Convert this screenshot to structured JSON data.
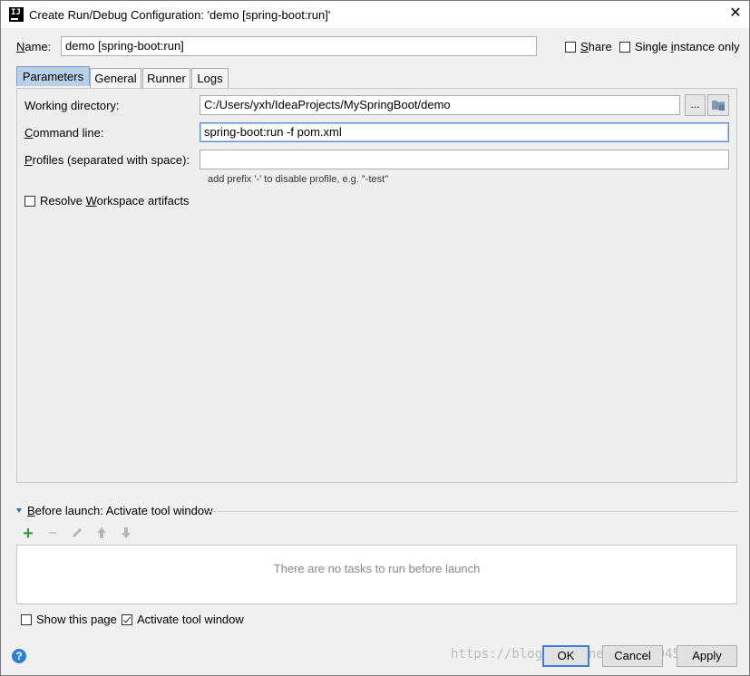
{
  "window": {
    "title": "Create Run/Debug Configuration: 'demo [spring-boot:run]'",
    "app_icon_text": "IJ",
    "close_icon": "close-icon"
  },
  "name_row": {
    "name_label_u": "N",
    "name_label_rest": "ame:",
    "name_value": "demo [spring-boot:run]",
    "share_label_u": "S",
    "share_label_rest": "hare",
    "share_checked": false,
    "single_label_pre": "Single ",
    "single_label_u": "i",
    "single_label_rest": "nstance only",
    "single_checked": false
  },
  "tabs": [
    {
      "label": "Parameters",
      "active": true
    },
    {
      "label": "General",
      "active": false
    },
    {
      "label": "Runner",
      "active": false
    },
    {
      "label": "Logs",
      "active": false
    }
  ],
  "parameters": {
    "working_dir_label": "Working directory:",
    "working_dir_value": "C:/Users/yxh/IdeaProjects/MySpringBoot/demo",
    "browse_label": "...",
    "command_line_label_u": "C",
    "command_line_label_rest": "ommand line:",
    "command_line_value": "spring-boot:run -f pom.xml",
    "profiles_label_u": "P",
    "profiles_label_rest": "rofiles (separated with space):",
    "profiles_value": "",
    "profiles_hint": "add prefix '-' to disable profile, e.g. \"-test\"",
    "resolve_label_pre": "Resolve ",
    "resolve_label_u": "W",
    "resolve_label_rest": "orkspace artifacts",
    "resolve_checked": false
  },
  "before_launch": {
    "header_u": "B",
    "header_rest": "efore launch: Activate tool window",
    "empty_text": "There are no tasks to run before launch",
    "toolbar_icons": [
      "add-icon",
      "remove-icon",
      "edit-icon",
      "move-up-icon",
      "move-down-icon"
    ]
  },
  "footer": {
    "show_page_label": "Show this page",
    "show_page_checked": false,
    "activate_label": "Activate tool window",
    "activate_checked": true,
    "ok_label": "OK",
    "cancel_label": "Cancel",
    "apply_label": "Apply",
    "help_icon": "?",
    "watermark": "https://blog.csdn.net/u012204535"
  },
  "colors": {
    "accent": "#3c7fd8",
    "add_green": "#3a9a3a",
    "tab_active": "#b8cfe8"
  }
}
